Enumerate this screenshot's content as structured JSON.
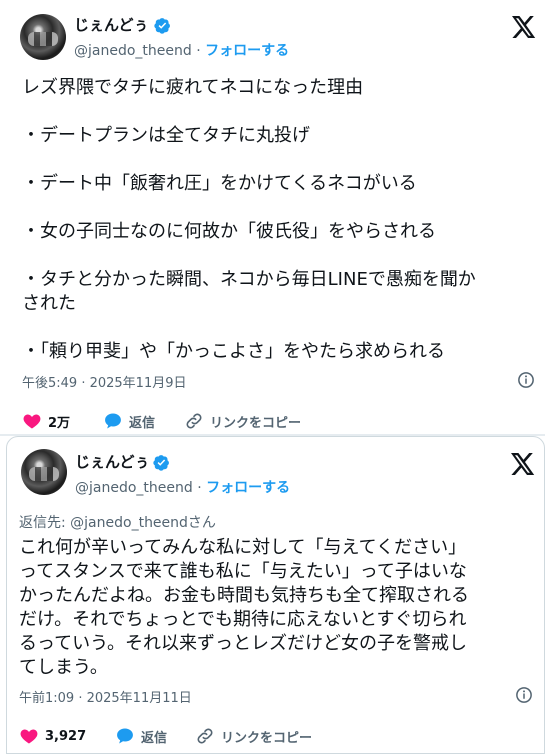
{
  "tweet1": {
    "display_name": "じぇんどぅ",
    "handle": "@janedo_theend",
    "separator": "·",
    "follow_label": "フォローする",
    "body": "レズ界隈でタチに疲れてネコになった理由\n\n・デートプランは全てタチに丸投げ\n\n・デート中「飯奢れ圧」をかけてくるネコがいる\n\n・女の子同士なのに何故か「彼氏役」をやらされる\n\n・タチと分かった瞬間、ネコから毎日LINEで愚痴を聞か\nされた\n\n・「頼り甲斐」や「かっこよさ」をやたら求められる",
    "timestamp": "午後5:49 · 2025年11月9日",
    "likes": "2万",
    "reply_label": "返信",
    "copy_link_label": "リンクをコピー"
  },
  "tweet2": {
    "display_name": "じぇんどぅ",
    "handle": "@janedo_theend",
    "separator": "·",
    "follow_label": "フォローする",
    "reply_to": "返信先: @janedo_theendさん",
    "body": "これ何が辛いってみんな私に対して「与えてください」\nってスタンスで来て誰も私に「与えたい」って子はいな\nかったんだよね。お金も時間も気持ちも全て搾取される\nだけ。それでちょっとでも期待に応えないとすぐ切られ\nるっていう。それ以来ずっとレズだけど女の子を警戒し\nてしまう。",
    "timestamp": "午前1:09 · 2025年11月11日",
    "likes": "3,927",
    "reply_label": "返信",
    "copy_link_label": "リンクをコピー"
  },
  "colors": {
    "verified": "#1d9bf0",
    "link": "#1d9bf0",
    "like": "#f91880",
    "muted": "#536471",
    "text": "#0f1419"
  },
  "icons": [
    "avatar",
    "verified-badge-icon",
    "x-logo-icon",
    "info-icon",
    "heart-icon",
    "reply-bubble-icon",
    "link-icon"
  ]
}
